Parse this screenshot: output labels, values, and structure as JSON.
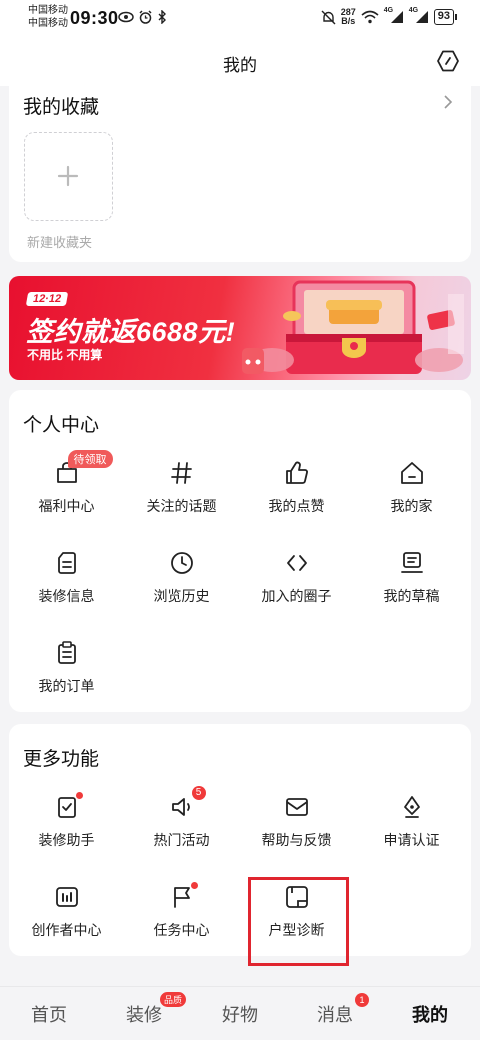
{
  "status_bar": {
    "carrier_1": "中国移动",
    "carrier_2": "中国移动",
    "time": "09:30",
    "net_speed_value": "287",
    "net_speed_unit": "B/s",
    "network_1": "4G",
    "network_2": "4G",
    "battery": "93"
  },
  "header": {
    "title": "我的"
  },
  "favorites": {
    "title": "我的收藏",
    "new_folder_label": "新建收藏夹"
  },
  "banner": {
    "badge": "12·12",
    "headline": "签约就返6688元!",
    "subtext": "不用比  不用算"
  },
  "personal_center": {
    "title": "个人中心",
    "items": [
      {
        "label": "福利中心",
        "icon": "gift-bag-icon",
        "tag": "待领取"
      },
      {
        "label": "关注的话题",
        "icon": "hashtag-icon"
      },
      {
        "label": "我的点赞",
        "icon": "thumbs-up-icon"
      },
      {
        "label": "我的家",
        "icon": "home-icon"
      },
      {
        "label": "装修信息",
        "icon": "document-icon"
      },
      {
        "label": "浏览历史",
        "icon": "clock-icon"
      },
      {
        "label": "加入的圈子",
        "icon": "code-brackets-icon"
      },
      {
        "label": "我的草稿",
        "icon": "draft-icon"
      },
      {
        "label": "我的订单",
        "icon": "clipboard-icon"
      }
    ]
  },
  "more_features": {
    "title": "更多功能",
    "items": [
      {
        "label": "装修助手",
        "icon": "checklist-icon",
        "dot": true
      },
      {
        "label": "热门活动",
        "icon": "megaphone-icon",
        "badge": "5"
      },
      {
        "label": "帮助与反馈",
        "icon": "mail-icon"
      },
      {
        "label": "申请认证",
        "icon": "pen-nib-icon"
      },
      {
        "label": "创作者中心",
        "icon": "bar-chart-icon"
      },
      {
        "label": "任务中心",
        "icon": "flag-icon",
        "dot": true
      },
      {
        "label": "户型诊断",
        "icon": "floor-plan-icon"
      }
    ]
  },
  "tab_bar": {
    "tabs": [
      {
        "label": "首页"
      },
      {
        "label": "装修",
        "badge": "品质"
      },
      {
        "label": "好物"
      },
      {
        "label": "消息",
        "badge": "1"
      },
      {
        "label": "我的",
        "active": true
      }
    ]
  },
  "colors": {
    "accent_red": "#e0252f",
    "badge_red": "#f03a3a",
    "background": "#f4f4f6"
  }
}
